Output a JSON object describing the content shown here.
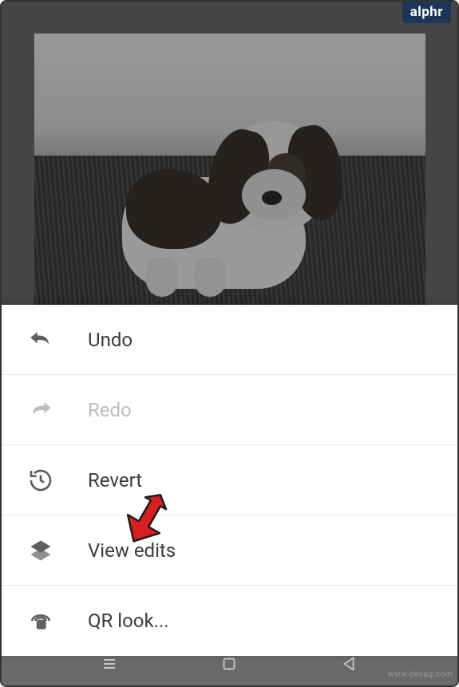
{
  "badge": "alphr",
  "watermark": "www.deuaq.com",
  "menu": {
    "undo": "Undo",
    "redo": "Redo",
    "revert": "Revert",
    "view_edits": "View edits",
    "qr_look": "QR look..."
  }
}
